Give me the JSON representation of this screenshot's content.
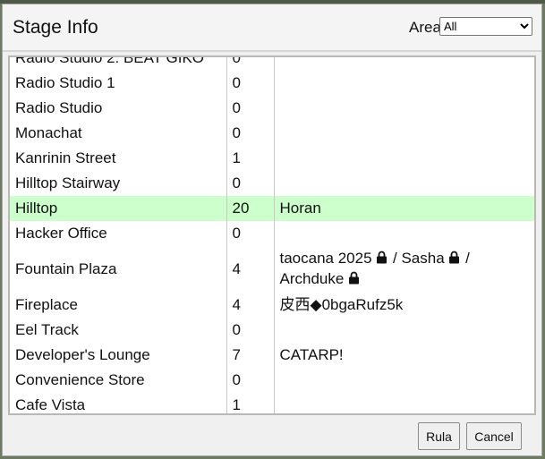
{
  "dialog": {
    "title": "Stage Info",
    "area_label": "Area",
    "area_selected": "All",
    "ok_label": "Rula",
    "cancel_label": "Cancel"
  },
  "stages": [
    {
      "name": "Radio Studio 2: BEAT GIKO",
      "count": "0",
      "users": []
    },
    {
      "name": "Radio Studio 1",
      "count": "0",
      "users": []
    },
    {
      "name": "Radio Studio",
      "count": "0",
      "users": []
    },
    {
      "name": "Monachat",
      "count": "0",
      "users": []
    },
    {
      "name": "Kanrinin Street",
      "count": "1",
      "users": []
    },
    {
      "name": "Hilltop Stairway",
      "count": "0",
      "users": []
    },
    {
      "name": "Hilltop",
      "count": "20",
      "users": [
        {
          "text": "Horan",
          "locked": false
        }
      ],
      "selected": true
    },
    {
      "name": "Hacker Office",
      "count": "0",
      "users": []
    },
    {
      "name": "Fountain Plaza",
      "count": "4",
      "users": [
        {
          "text": "taocana 2025",
          "locked": true
        },
        {
          "text": "Sasha",
          "locked": true
        },
        {
          "text": "Archduke",
          "locked": true
        }
      ]
    },
    {
      "name": "Fireplace",
      "count": "4",
      "users": [
        {
          "text": "皮西◆0bgaRufz5k",
          "locked": false
        }
      ]
    },
    {
      "name": "Eel Track",
      "count": "0",
      "users": []
    },
    {
      "name": "Developer's Lounge",
      "count": "7",
      "users": [
        {
          "text": "CATARP!",
          "locked": false
        }
      ]
    },
    {
      "name": "Convenience Store",
      "count": "0",
      "users": []
    },
    {
      "name": "Cafe Vista",
      "count": "1",
      "users": []
    }
  ]
}
